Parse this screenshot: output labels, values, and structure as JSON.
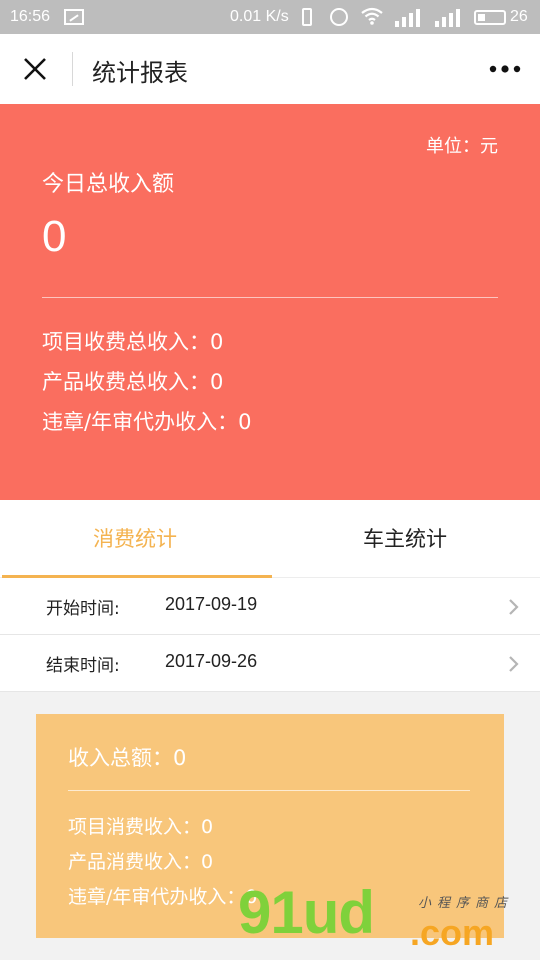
{
  "statusbar": {
    "time": "16:56",
    "speed": "0.01 K/s",
    "battery": "26"
  },
  "navbar": {
    "title": "统计报表"
  },
  "summary": {
    "unit_label": "单位：元",
    "today_label": "今日总收入额",
    "today_value": "0",
    "rows": [
      {
        "label": "项目收费总收入：0"
      },
      {
        "label": "产品收费总收入：0"
      },
      {
        "label": "违章/年审代办收入：0"
      }
    ],
    "colors": {
      "background": "#fa6e5f"
    }
  },
  "tabs": [
    {
      "label": "消费统计",
      "active": true
    },
    {
      "label": "车主统计",
      "active": false
    }
  ],
  "dates": {
    "start_label": "开始时间:",
    "start_value": "2017-09-19",
    "end_label": "结束时间:",
    "end_value": "2017-09-26"
  },
  "card": {
    "total_label": "收入总额：0",
    "rows": [
      {
        "label": "项目消费收入：0"
      },
      {
        "label": "产品消费收入：0"
      },
      {
        "label": "违章/年审代办收入：0"
      }
    ],
    "colors": {
      "background": "#f8c67b",
      "accent": "#f4b350"
    }
  },
  "watermark": {
    "main": "91ud",
    "domain": ".com",
    "sub": "小程序商店"
  }
}
